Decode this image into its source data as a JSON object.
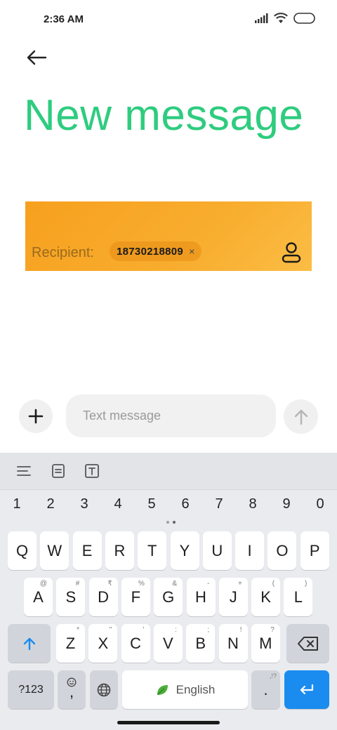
{
  "status_bar": {
    "time": "2:36 AM"
  },
  "header": {
    "title": "New message"
  },
  "recipient": {
    "label": "Recipient:",
    "chip_number": "18730218809",
    "chip_remove": "×"
  },
  "compose": {
    "placeholder": "Text message"
  },
  "colors": {
    "title_green": "#2ecc7f",
    "panel_orange": "#f7a01f",
    "accent_blue": "#1a8cf0"
  },
  "keyboard": {
    "toolbar": [
      "menu-lines-icon",
      "clipboard-icon",
      "text-format-icon"
    ],
    "numbers": [
      "1",
      "2",
      "3",
      "4",
      "5",
      "6",
      "7",
      "8",
      "9",
      "0"
    ],
    "row1": [
      {
        "k": "Q",
        "h": ""
      },
      {
        "k": "W",
        "h": ""
      },
      {
        "k": "E",
        "h": ""
      },
      {
        "k": "R",
        "h": ""
      },
      {
        "k": "T",
        "h": ""
      },
      {
        "k": "Y",
        "h": ""
      },
      {
        "k": "U",
        "h": ""
      },
      {
        "k": "I",
        "h": ""
      },
      {
        "k": "O",
        "h": ""
      },
      {
        "k": "P",
        "h": ""
      }
    ],
    "row2": [
      {
        "k": "A",
        "h": "@"
      },
      {
        "k": "S",
        "h": "#"
      },
      {
        "k": "D",
        "h": "₹"
      },
      {
        "k": "F",
        "h": "%"
      },
      {
        "k": "G",
        "h": "&"
      },
      {
        "k": "H",
        "h": "-"
      },
      {
        "k": "J",
        "h": "+"
      },
      {
        "k": "K",
        "h": "("
      },
      {
        "k": "L",
        "h": ")"
      }
    ],
    "row3": [
      {
        "k": "Z",
        "h": "*"
      },
      {
        "k": "X",
        "h": "\""
      },
      {
        "k": "C",
        "h": "'"
      },
      {
        "k": "V",
        "h": ":"
      },
      {
        "k": "B",
        "h": ";"
      },
      {
        "k": "N",
        "h": "!"
      },
      {
        "k": "M",
        "h": "?"
      }
    ],
    "symbols_label": "?123",
    "comma_label": ",",
    "space_label": "English",
    "period_label": ".",
    "period_hint": ",!?"
  }
}
